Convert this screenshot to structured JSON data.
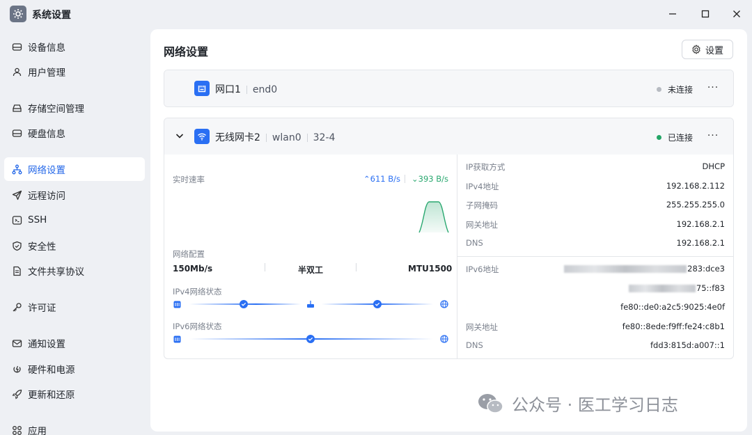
{
  "window": {
    "title": "系统设置"
  },
  "sidebar": {
    "items": [
      {
        "label": "设备信息",
        "icon": "device-icon"
      },
      {
        "label": "用户管理",
        "icon": "user-icon"
      },
      {
        "label": "存储空间管理",
        "icon": "storage-icon"
      },
      {
        "label": "硬盘信息",
        "icon": "disk-icon"
      },
      {
        "label": "网络设置",
        "icon": "network-icon",
        "active": true
      },
      {
        "label": "远程访问",
        "icon": "send-icon"
      },
      {
        "label": "SSH",
        "icon": "terminal-icon"
      },
      {
        "label": "安全性",
        "icon": "shield-icon"
      },
      {
        "label": "文件共享协议",
        "icon": "file-icon"
      },
      {
        "label": "许可证",
        "icon": "key-icon"
      },
      {
        "label": "通知设置",
        "icon": "mail-icon"
      },
      {
        "label": "硬件和电源",
        "icon": "power-icon"
      },
      {
        "label": "更新和还原",
        "icon": "rocket-icon"
      },
      {
        "label": "应用",
        "icon": "apps-icon"
      }
    ]
  },
  "main": {
    "title": "网络设置",
    "settings_label": "设置",
    "iface1": {
      "name": "网口1",
      "device": "end0",
      "status": "未连接",
      "status_color": "#b7bbc2"
    },
    "iface2": {
      "name": "无线网卡2",
      "device": "wlan0",
      "extra": "32-4",
      "status": "已连接",
      "status_color": "#23a566",
      "realtime_label": "实时速率",
      "upload": "⌃611 B/s",
      "download": "⌄393 B/s",
      "config_label": "网络配置",
      "speed": "150Mb/s",
      "duplex": "半双工",
      "mtu": "MTU1500",
      "ipv4_status_label": "IPv4网络状态",
      "ipv6_status_label": "IPv6网络状态",
      "ipv4": [
        {
          "k": "IP获取方式",
          "v": "DHCP"
        },
        {
          "k": "IPv4地址",
          "v": "192.168.2.112"
        },
        {
          "k": "子网掩码",
          "v": "255.255.255.0"
        },
        {
          "k": "网关地址",
          "v": "192.168.2.1"
        },
        {
          "k": "DNS",
          "v": "192.168.2.1"
        }
      ],
      "ipv6_label": "IPv6地址",
      "ipv6_addr1_suffix": "283:dce3",
      "ipv6_addr2_suffix": "75::f83",
      "ipv6_addr3": "fe80::de0:a2c5:9025:4e0f",
      "ipv6_gateway_label": "网关地址",
      "ipv6_gateway": "fe80::8ede:f9ff:fe24:c8b1",
      "ipv6_dns_label": "DNS",
      "ipv6_dns": "fdd3:815d:a007::1"
    }
  },
  "watermark": {
    "text": "公众号 · 医工学习日志"
  }
}
